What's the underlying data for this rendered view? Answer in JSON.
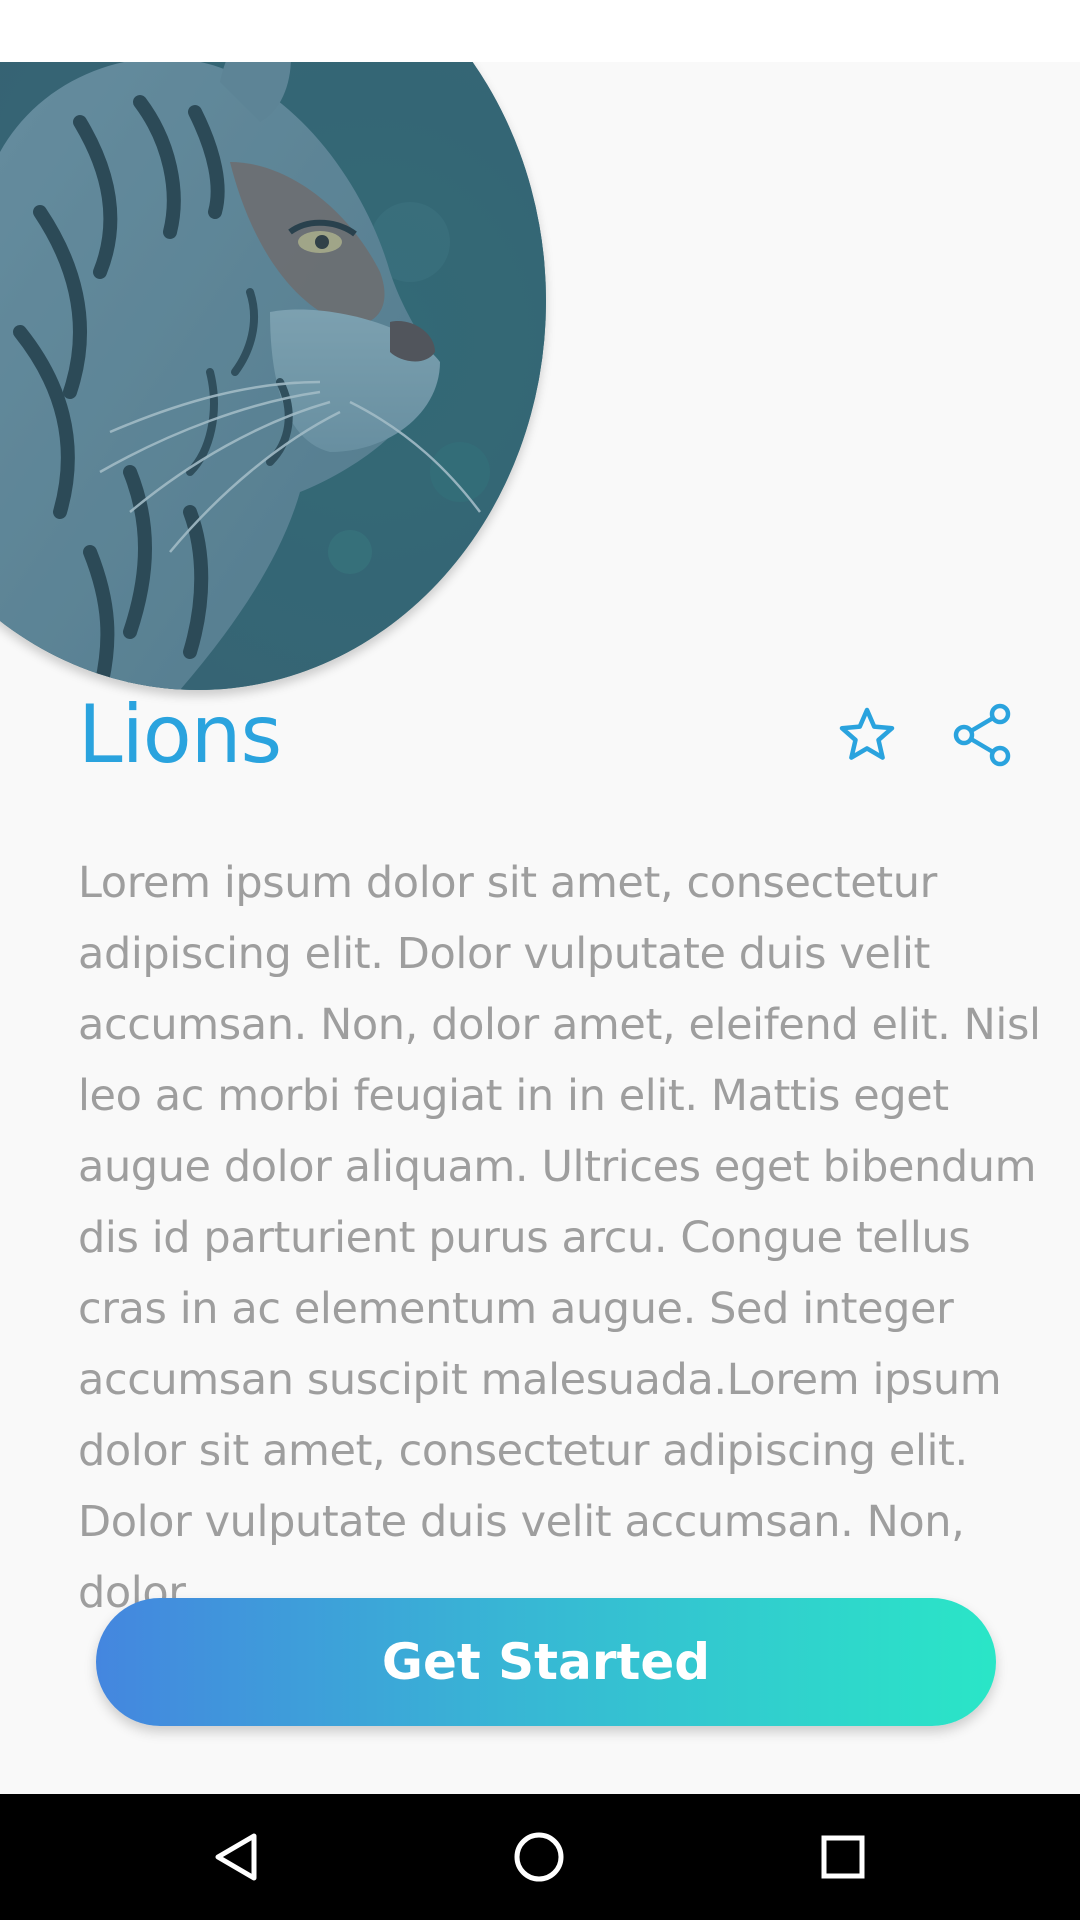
{
  "screen": {
    "title": "Lions",
    "description": "Lorem ipsum dolor sit amet, consectetur adipiscing elit. Dolor vulputate duis velit accumsan. Non, dolor amet, eleifend elit. Nisl leo ac morbi feugiat in in elit. Mattis eget augue dolor aliquam. Ultrices eget bibendum dis id parturient purus arcu. Congue tellus cras in ac elementum augue. Sed integer accumsan suscipit malesuada.Lorem ipsum dolor sit amet, consectetur adipiscing elit. Dolor vulputate duis velit accumsan. Non, dolor",
    "cta_label": "Get Started"
  },
  "icons": {
    "favorite": "star-icon",
    "share": "share-icon",
    "nav_back": "back-triangle-icon",
    "nav_home": "home-circle-icon",
    "nav_recent": "recent-square-icon"
  },
  "colors": {
    "title": "#2aa3de",
    "body_text": "#9e9e9e",
    "gradient_start": "#4486df",
    "gradient_end": "#2ae6c7",
    "background": "#f9f9f9",
    "nav_bar": "#000000"
  }
}
